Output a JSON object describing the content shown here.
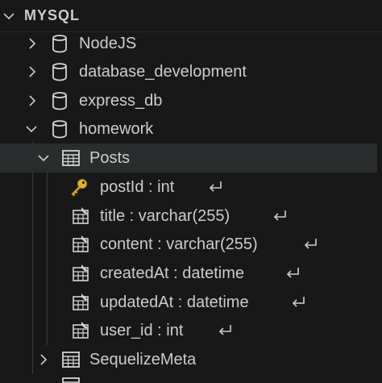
{
  "section": {
    "title": "MYSQL"
  },
  "databases": [
    {
      "label": "NodeJS",
      "expanded": false
    },
    {
      "label": "database_development",
      "expanded": false
    },
    {
      "label": "express_db",
      "expanded": false
    },
    {
      "label": "homework",
      "expanded": true
    }
  ],
  "tables": [
    {
      "label": "Posts",
      "expanded": true,
      "selected": true
    },
    {
      "label": "SequelizeMeta",
      "expanded": false
    }
  ],
  "columns": [
    {
      "label": "postId : int",
      "key": "primary"
    },
    {
      "label": "title : varchar(255)",
      "key": "none"
    },
    {
      "label": "content : varchar(255)",
      "key": "none"
    },
    {
      "label": "createdAt : datetime",
      "key": "none"
    },
    {
      "label": "updatedAt : datetime",
      "key": "none"
    },
    {
      "label": "user_id : int",
      "key": "none"
    }
  ],
  "icons": {
    "database": "database-icon",
    "table": "table-icon",
    "primary_key": "key-icon",
    "column": "column-icon",
    "enter": "return-arrow-icon"
  },
  "colors": {
    "background": "#181818",
    "text": "#cccccc",
    "selected_row": "#2a2d2e",
    "key_gold": "#e2b13c"
  }
}
